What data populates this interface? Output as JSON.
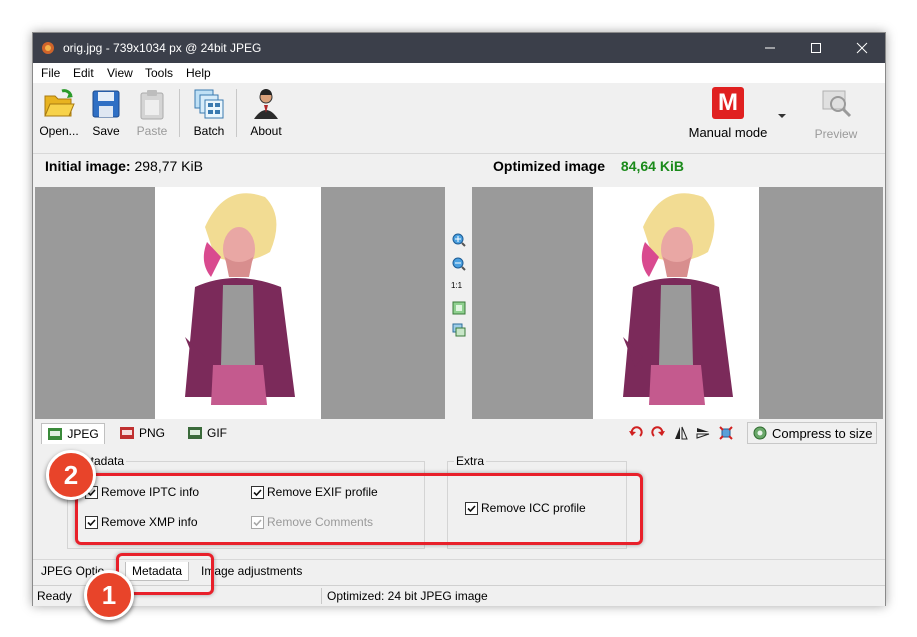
{
  "window": {
    "title": "orig.jpg - 739x1034 px @ 24bit JPEG",
    "minimize_glyph": "—",
    "maximize_glyph": "☐",
    "close_glyph": "✕"
  },
  "menu": [
    "File",
    "Edit",
    "View",
    "Tools",
    "Help"
  ],
  "toolbar": {
    "open": "Open...",
    "save": "Save",
    "paste": "Paste",
    "batch": "Batch",
    "about": "About",
    "mode_letter": "M",
    "mode": "Manual mode",
    "preview": "Preview"
  },
  "initial": {
    "label": "Initial image:",
    "size": "298,77 KiB"
  },
  "optimized": {
    "label": "Optimized image",
    "size": "84,64 KiB",
    "size_color": "#1a8a1a"
  },
  "zoom_tools": {
    "one_to_one": "1:1"
  },
  "format_tabs": [
    "JPEG",
    "PNG",
    "GIF"
  ],
  "compress_to_size": "Compress to size",
  "metadata_group": {
    "title": "etadata",
    "remove_iptc": "Remove IPTC info",
    "remove_exif": "Remove EXIF profile",
    "remove_xmp": "Remove XMP info",
    "remove_comments": "Remove Comments"
  },
  "extra_group": {
    "title": "Extra",
    "remove_icc": "Remove ICC profile"
  },
  "bottom_tabs": {
    "jpeg_options": "JPEG Optio",
    "metadata": "Metadata",
    "image_adjustments": "Image adjustments"
  },
  "status": {
    "left": "Ready",
    "right": "Optimized: 24 bit JPEG image"
  },
  "callouts": {
    "one": "1",
    "two": "2"
  },
  "colors": {
    "accent_red": "#e8202a",
    "titlebar": "#3b3f4a",
    "mode_red": "#e02020"
  }
}
